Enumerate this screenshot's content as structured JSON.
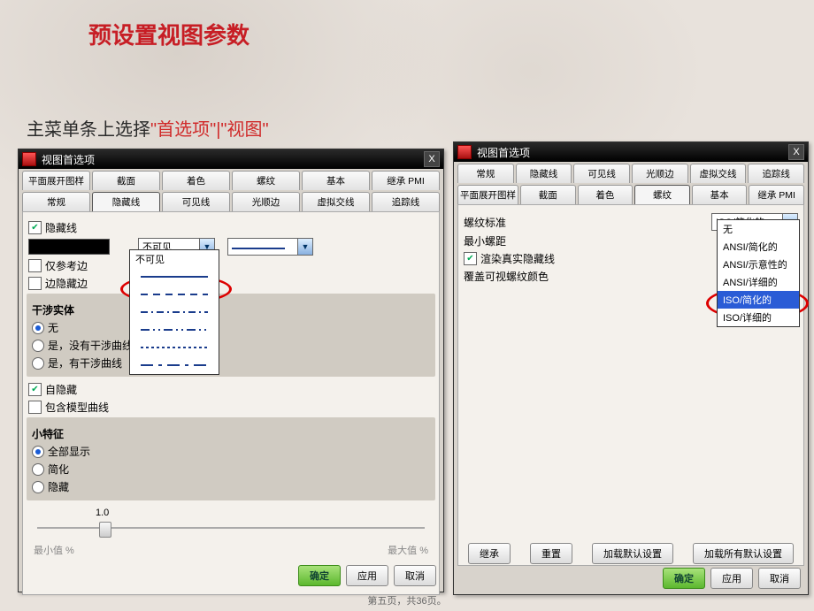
{
  "slide": {
    "title": "预设置视图参数",
    "subtitle_black": "主菜单条上选择",
    "subtitle_red": "\"首选项\"|\"视图\"",
    "footer": "第五页，共36页。"
  },
  "dialog": {
    "title": "视图首选项",
    "close": "X",
    "tabs_row1": [
      "平面展开图样",
      "截面",
      "着色",
      "螺纹",
      "基本",
      "继承 PMI"
    ],
    "tabs_row2": [
      "常规",
      "隐藏线",
      "可见线",
      "光顺边",
      "虚拟交线",
      "追踪线"
    ],
    "active_tab_left": "隐藏线",
    "active_tab_right": "螺纹"
  },
  "left": {
    "hidden_line_chk": "隐藏线",
    "only_ref_edges": "仅参考边",
    "edge_hide_edges": "边隐藏边",
    "combo_visibility": "不可见",
    "dropdown_opts": [
      "不可见"
    ],
    "interfere_label": "干涉实体",
    "interfere_opts": [
      "无",
      "是，没有干涉曲线",
      "是，有干涉曲线"
    ],
    "self_hide": "自隐藏",
    "include_model_curves": "包含模型曲线",
    "small_feat_label": "小特征",
    "small_feat_opts": [
      "全部显示",
      "简化",
      "隐藏"
    ],
    "slider_val": "1.0",
    "min_label": "最小值 %",
    "max_label": "最大值 %"
  },
  "right": {
    "thread_std": "螺纹标准",
    "min_pitch": "最小螺距",
    "render_real": "渲染真实隐藏线",
    "override_color": "覆盖可视螺纹颜色",
    "std_combo": "ISO/简化的",
    "std_opts": [
      "无",
      "ANSI/简化的",
      "ANSI/示意性的",
      "ANSI/详细的",
      "ISO/简化的",
      "ISO/详细的"
    ],
    "btn_inherit": "继承",
    "btn_reset": "重置",
    "btn_load_default": "加载默认设置",
    "btn_load_all_default": "加载所有默认设置"
  },
  "buttons": {
    "ok": "确定",
    "apply": "应用",
    "cancel": "取消"
  }
}
